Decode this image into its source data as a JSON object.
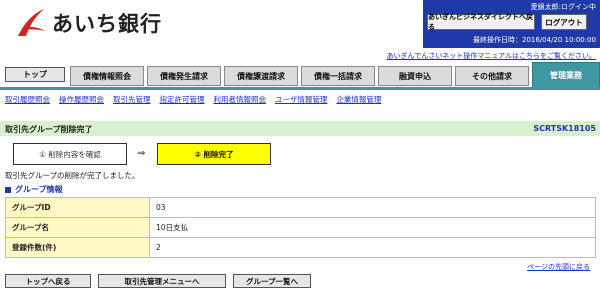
{
  "header": {
    "bank_name": "あいち銀行",
    "user_status": "愛銀太郎:ログイン中",
    "direct_button": "あいぎんビジネスダイレクトへ戻る",
    "logout_button": "ログアウト",
    "last_login": "最終操作日時：2016/04/20 10:00:00",
    "manual_link": "あいぎんでんさいネット操作マニュアルはこちらをご覧ください。"
  },
  "tabs": [
    {
      "label": "トップ"
    },
    {
      "label": "債権情報照会"
    },
    {
      "label": "債権発生請求"
    },
    {
      "label": "債権譲渡請求"
    },
    {
      "label": "債権一括請求"
    },
    {
      "label": "融資申込"
    },
    {
      "label": "その他請求"
    },
    {
      "label": "管理業務"
    }
  ],
  "subnav": [
    {
      "label": "取引履歴照会"
    },
    {
      "label": "操作履歴照会"
    },
    {
      "label": "取引先管理"
    },
    {
      "label": "指定許可管理"
    },
    {
      "label": "利用者情報照会"
    },
    {
      "label": "ユーザ情報管理"
    },
    {
      "label": "企業情報管理"
    }
  ],
  "page": {
    "title": "取引先グループ削除完了",
    "screen_id": "SCRTSK18105",
    "step1": "① 削除内容を確認",
    "step_arrow": "⇒",
    "step2": "② 削除完了",
    "message": "取引先グループの削除が完了しました。",
    "section_title": "グループ情報",
    "page_top_link": "ページの先頭に戻る"
  },
  "table": [
    {
      "label": "グループID",
      "value": "03"
    },
    {
      "label": "グループ名",
      "value": "10日支払"
    },
    {
      "label": "登録件数(件)",
      "value": "2"
    }
  ],
  "buttons": {
    "top": "トップへ戻る",
    "menu": "取引先管理メニューへ",
    "list": "グループ一覧へ"
  },
  "colors": {
    "header_blue": "#1f3aa8",
    "logo_red": "#d7231c",
    "active_tab": "#3f97a3",
    "title_bar": "#d9f0cc",
    "step_active": "#ffff00",
    "table_label_bg": "#fff9c8"
  }
}
